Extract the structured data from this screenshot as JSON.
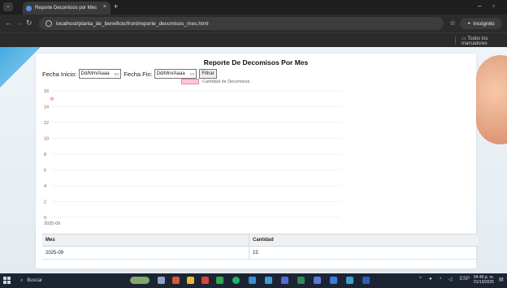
{
  "browser": {
    "tab_title": "Reporte Decomisos por Mes",
    "tab_close": "×",
    "new_tab": "+",
    "url": "localhost/planta_de_beneficio/front/reporte_decomisos_mes.html",
    "profile_label": "Incógnito",
    "bookmarks_all": "Todos los marcadores"
  },
  "page": {
    "title": "Reporte De Decomisos Por Mes",
    "fecha_inicio_label": "Fecha Inicio:",
    "fecha_inicio_placeholder": "Dd/Mm/Aaaa",
    "fecha_fin_label": "Fecha Fin:",
    "fecha_fin_placeholder": "Dd/Mm/Aaaa",
    "filter_button": "Filtrar"
  },
  "chart_data": {
    "type": "line",
    "categories": [
      "2025-09"
    ],
    "series": [
      {
        "name": "Cantidad de Decomisos",
        "values": [
          15
        ]
      }
    ],
    "ylim": [
      0,
      16
    ],
    "yticks": [
      0,
      2,
      4,
      6,
      8,
      10,
      12,
      14,
      16
    ],
    "grid": true,
    "legend": "top-center",
    "colors": {
      "line": "#e98aa3",
      "fill": "#f9c7d3"
    }
  },
  "table": {
    "headers": [
      "Mes",
      "Cantidad"
    ],
    "rows": [
      [
        "2025-09",
        "15"
      ]
    ]
  },
  "taskbar": {
    "search_placeholder": "Buscar",
    "lang": "ESP",
    "time": "04:40 p. m.",
    "date": "01/10/2025"
  }
}
